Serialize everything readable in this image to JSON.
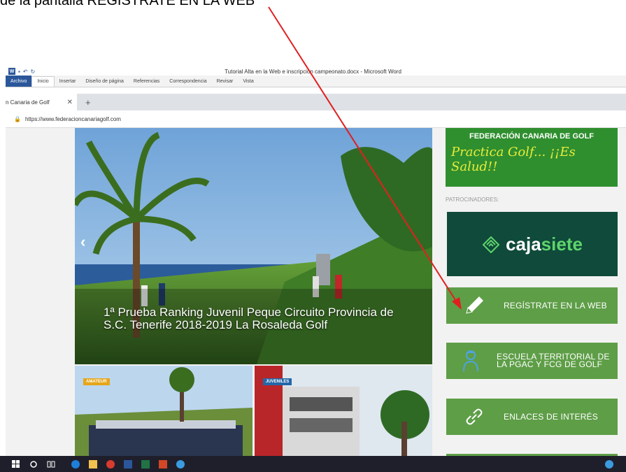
{
  "caption": "de la pantalla REGISTRATE EN LA WEB",
  "word": {
    "title": "Tutorial Alta en la Web e inscripción campeonato.docx  -  Microsoft Word",
    "ribbon_tabs": [
      "Archivo",
      "Inicio",
      "Insertar",
      "Diseño de página",
      "Referencias",
      "Correspondencia",
      "Revisar",
      "Vista"
    ]
  },
  "browser": {
    "tab_title": "n Canaria de Golf",
    "url": "https://www.federacioncanariagolf.com"
  },
  "hero": {
    "caption": "1ª Prueba Ranking Juvenil Peque Circuito Provincia de S.C. Tenerife 2018-2019 La Rosaleda Golf"
  },
  "thumbs": [
    {
      "badge": "AMATEUR"
    },
    {
      "badge": "JUVENILES"
    }
  ],
  "sidebar": {
    "banner_title": "FEDERACIÓN CANARIA DE GOLF",
    "banner_slogan": "Practica Golf... ¡¡Es Salud!!",
    "sponsors_label": "PATROCINADORES:",
    "sponsor_name_a": "caja",
    "sponsor_name_b": "siete",
    "buttons": [
      {
        "label": "REGÍSTRATE EN LA WEB",
        "icon": "pencil-icon"
      },
      {
        "label": "ESCUELA TERRITORIAL DE LA PGAC Y FCG DE GOLF",
        "icon": "golfer-icon"
      },
      {
        "label": "ENLACES DE INTERÉS",
        "icon": "link-icon"
      }
    ]
  },
  "colors": {
    "menu_green": "#5e9e47",
    "banner_green": "#2f8f2f",
    "sponsor_bg": "#0f4a3a",
    "arrow_red": "#e02020"
  }
}
